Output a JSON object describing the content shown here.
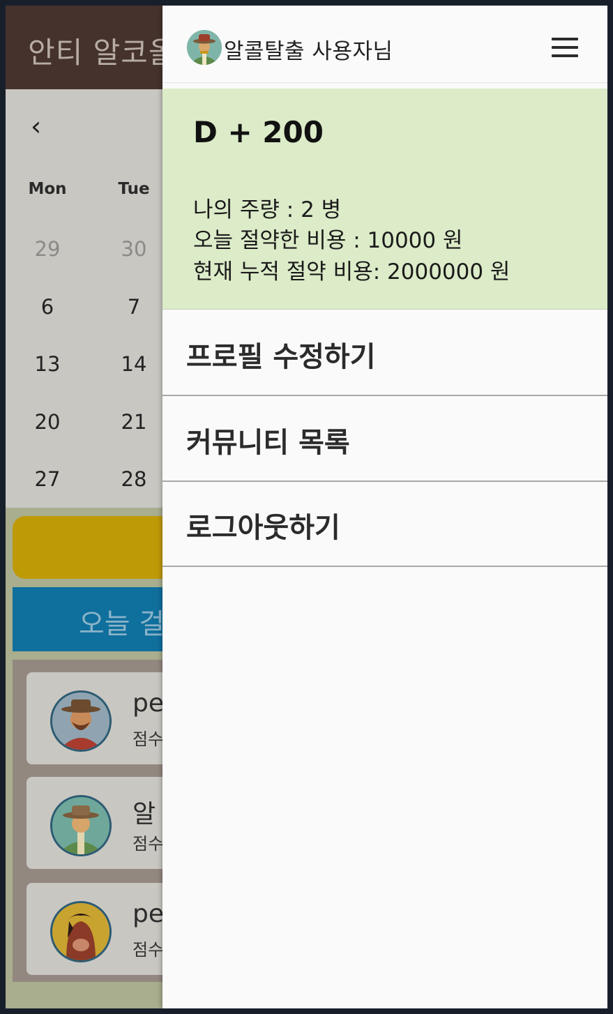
{
  "background_app": {
    "title": "안티 알코올",
    "calendar": {
      "prev_icon": "chevron-left-icon",
      "weekdays": [
        "Mon",
        "Tue"
      ],
      "weeks": [
        [
          "29",
          "30"
        ],
        [
          "6",
          "7"
        ],
        [
          "13",
          "14"
        ],
        [
          "20",
          "21"
        ],
        [
          "27",
          "28"
        ]
      ]
    },
    "blue_bar_label": "오늘 걸",
    "cards": [
      {
        "name": "pe",
        "score": "점수"
      },
      {
        "name": "알",
        "score": "점수"
      },
      {
        "name": "pe",
        "score": "점수"
      }
    ]
  },
  "drawer": {
    "user_name": "알콜탈출 사용자님",
    "menu_icon": "hamburger-menu-icon",
    "dday": "D + 200",
    "stats": {
      "drink_amount": "나의 주량 : 2 병",
      "saved_today": "오늘 절약한 비용 :  10000 원",
      "saved_total": "현재 누적 절약 비용: 2000000 원"
    },
    "menu_items": [
      {
        "label": "프로필 수정하기"
      },
      {
        "label": "커뮤니티 목록"
      },
      {
        "label": "로그아웃하기"
      }
    ]
  },
  "colors": {
    "appbar": "#45322c",
    "stats_background": "#dcebc8",
    "drawer_background": "#fafafa",
    "yellow_button": "#bf9a07",
    "blue_bar": "#0f6f9d"
  }
}
